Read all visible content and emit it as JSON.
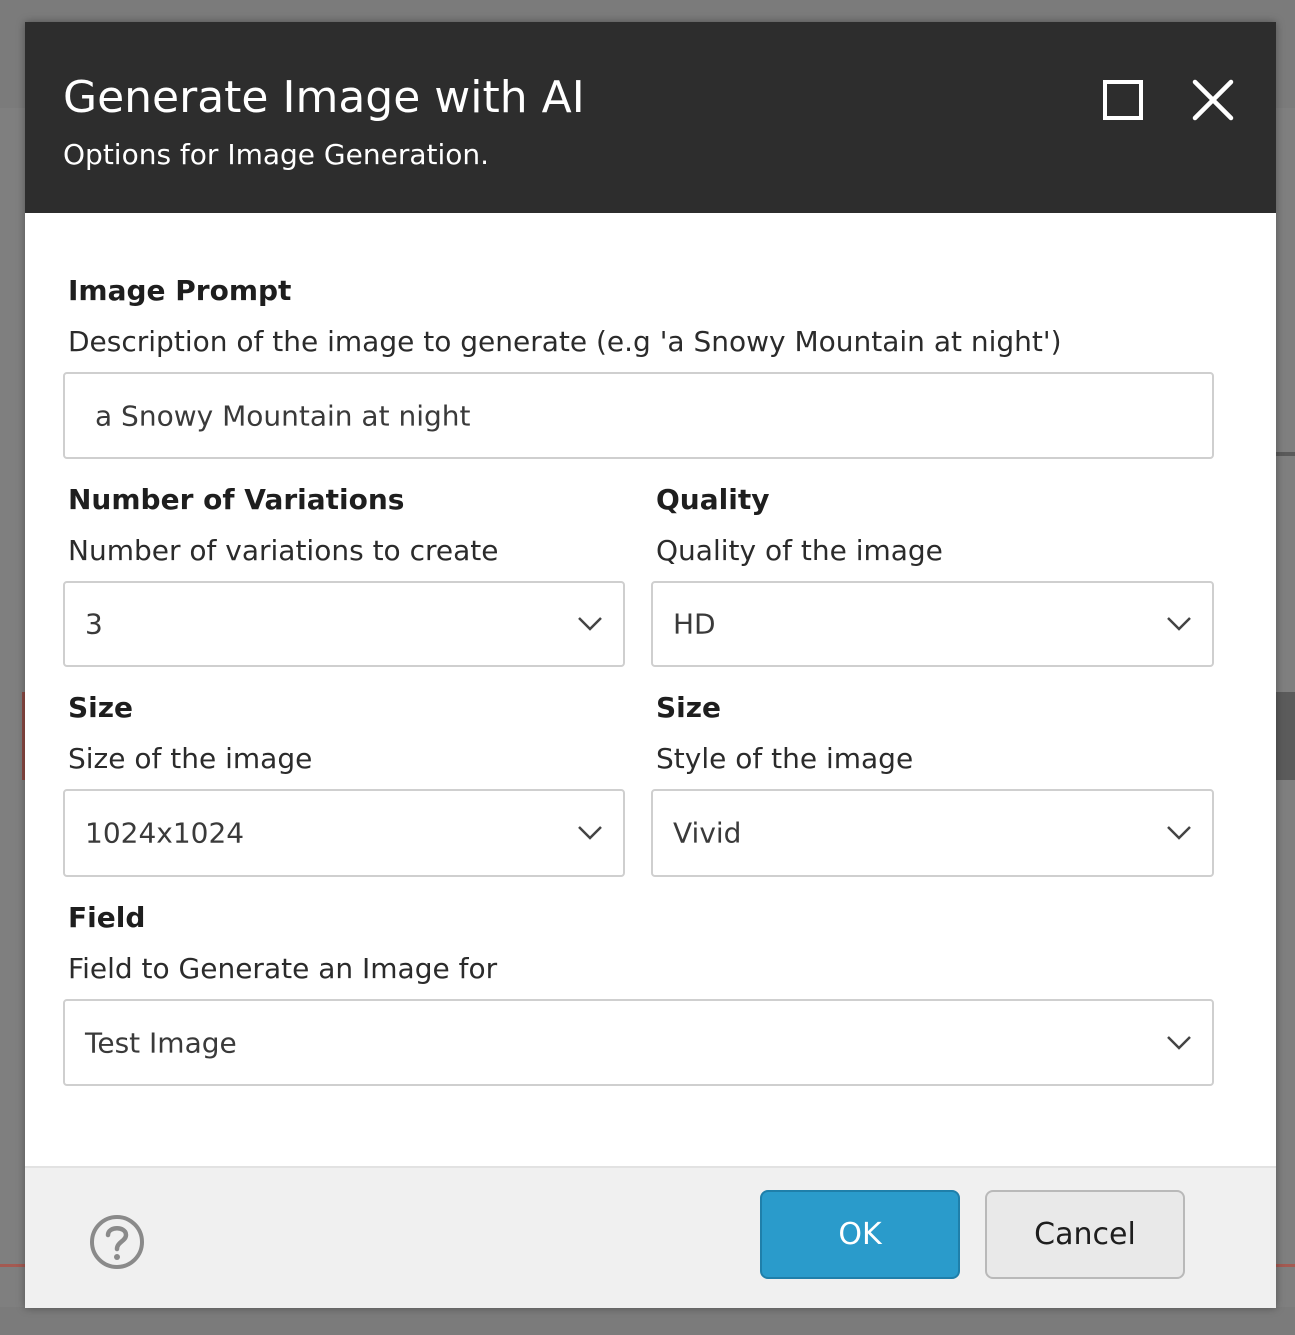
{
  "dialog": {
    "title": "Generate Image with AI",
    "subtitle": "Options for Image Generation.",
    "maximize_icon": "maximize-icon",
    "close_icon": "close-icon"
  },
  "fields": {
    "prompt": {
      "label": "Image Prompt",
      "help": "Description of the image to generate (e.g 'a Snowy Mountain at night')",
      "value": "a Snowy Mountain at night"
    },
    "variations": {
      "label": "Number of Variations",
      "help": "Number of variations to create",
      "value": "3"
    },
    "quality": {
      "label": "Quality",
      "help": "Quality of the image",
      "value": "HD"
    },
    "size": {
      "label": "Size",
      "help": "Size of the image",
      "value": "1024x1024"
    },
    "style": {
      "label": "Size",
      "help": "Style of the image",
      "value": "Vivid"
    },
    "target_field": {
      "label": "Field",
      "help": "Field to Generate an Image for",
      "value": "Test Image"
    }
  },
  "footer": {
    "help_icon": "help-circle-icon",
    "ok_label": "OK",
    "cancel_label": "Cancel"
  },
  "colors": {
    "header_bg": "#2d2d2d",
    "primary_button": "#2a9bcb",
    "overlay": "#7b7b7b"
  }
}
